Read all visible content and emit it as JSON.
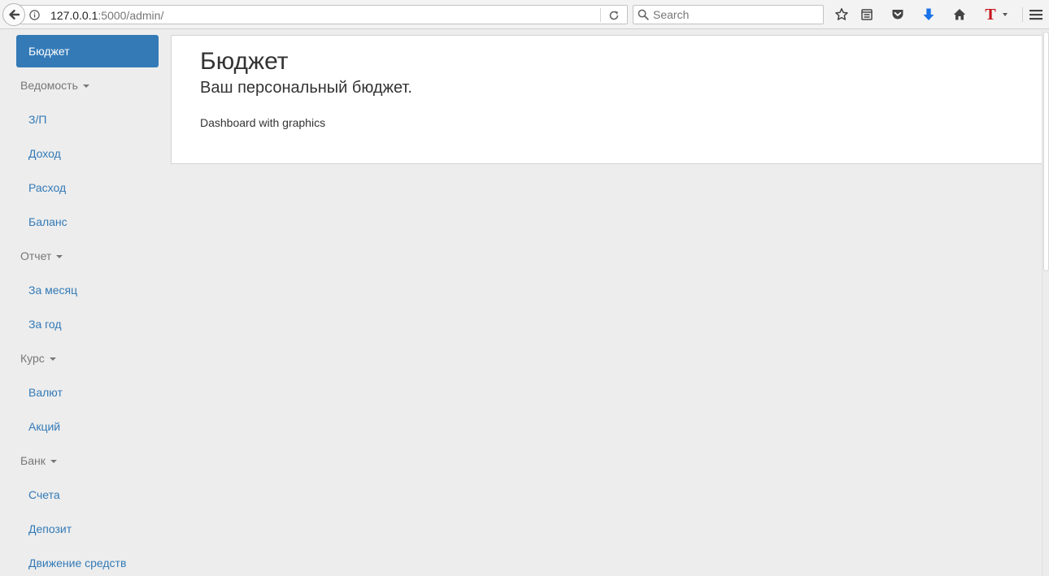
{
  "browser": {
    "url_host": "127.0.0.1",
    "url_rest": ":5000/admin/",
    "search_placeholder": "Search",
    "icons": [
      "back-arrow-icon",
      "info-icon",
      "reload-icon",
      "search-icon",
      "bookmark-star-icon",
      "reading-list-icon",
      "pocket-icon",
      "download-icon",
      "home-icon",
      "translate-t-icon",
      "hamburger-menu-icon"
    ],
    "accent_colors": {
      "download": "#1a73e8",
      "translate": "#c4161c"
    }
  },
  "sidebar": {
    "active": {
      "label": "Бюджет"
    },
    "groups": [
      {
        "label": "Ведомость",
        "items": [
          "З/П",
          "Доход",
          "Расход",
          "Баланс"
        ]
      },
      {
        "label": "Отчет",
        "items": [
          "За месяц",
          "За год"
        ]
      },
      {
        "label": "Курс",
        "items": [
          "Валют",
          "Акций"
        ]
      },
      {
        "label": "Банк",
        "items": [
          "Счета",
          "Депозит",
          "Движение средств"
        ]
      }
    ],
    "colors": {
      "active_bg": "#337ab7",
      "link": "#337ab7",
      "group": "#777777"
    }
  },
  "main": {
    "title": "Бюджет",
    "subtitle": "Ваш персональный бюджет.",
    "text": "Dashboard with graphics"
  }
}
